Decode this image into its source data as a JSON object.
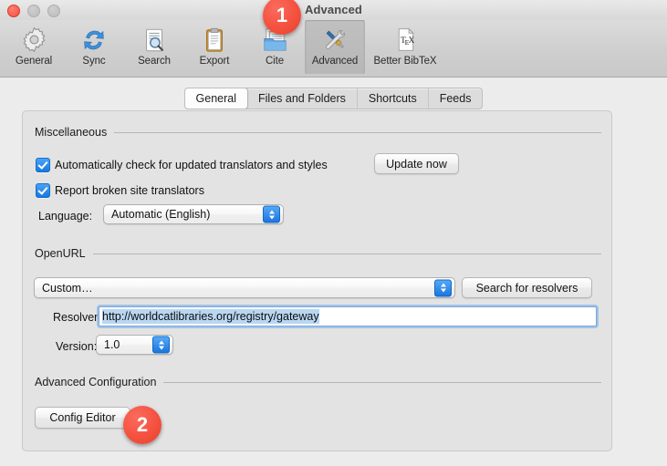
{
  "window": {
    "title": "Advanced",
    "traffic_lights": [
      "close",
      "minimize",
      "maximize"
    ]
  },
  "toolbar": {
    "items": [
      {
        "label": "General",
        "icon": "gear-icon",
        "selected": false
      },
      {
        "label": "Sync",
        "icon": "sync-icon",
        "selected": false
      },
      {
        "label": "Search",
        "icon": "search-doc-icon",
        "selected": false
      },
      {
        "label": "Export",
        "icon": "clipboard-icon",
        "selected": false
      },
      {
        "label": "Cite",
        "icon": "cite-folder-icon",
        "selected": false
      },
      {
        "label": "Advanced",
        "icon": "wrench-screwdriver-icon",
        "selected": true
      },
      {
        "label": "Better BibTeX",
        "icon": "tex-page-icon",
        "selected": false
      }
    ]
  },
  "tabs": [
    {
      "label": "General",
      "active": true
    },
    {
      "label": "Files and Folders",
      "active": false
    },
    {
      "label": "Shortcuts",
      "active": false
    },
    {
      "label": "Feeds",
      "active": false
    }
  ],
  "miscellaneous": {
    "heading": "Miscellaneous",
    "auto_check": {
      "label": "Automatically check for updated translators and styles",
      "checked": true
    },
    "report_broken": {
      "label": "Report broken site translators",
      "checked": true
    },
    "update_now_label": "Update now",
    "language_label": "Language:",
    "language_value": "Automatic (English)"
  },
  "openurl": {
    "heading": "OpenURL",
    "resolver_select_value": "Custom…",
    "search_resolvers_label": "Search for resolvers",
    "resolver_label": "Resolver:",
    "resolver_value": "http://worldcatlibraries.org/registry/gateway",
    "version_label": "Version:",
    "version_value": "1.0"
  },
  "advanced_config": {
    "heading": "Advanced Configuration",
    "config_editor_label": "Config Editor"
  },
  "annotations": [
    {
      "number": "1",
      "target": "advanced-toolbar-item"
    },
    {
      "number": "2",
      "target": "config-editor-button"
    }
  ],
  "colors": {
    "badge": "#f4513f",
    "accent": "#1a76df",
    "selection": "#b9d6f2"
  }
}
